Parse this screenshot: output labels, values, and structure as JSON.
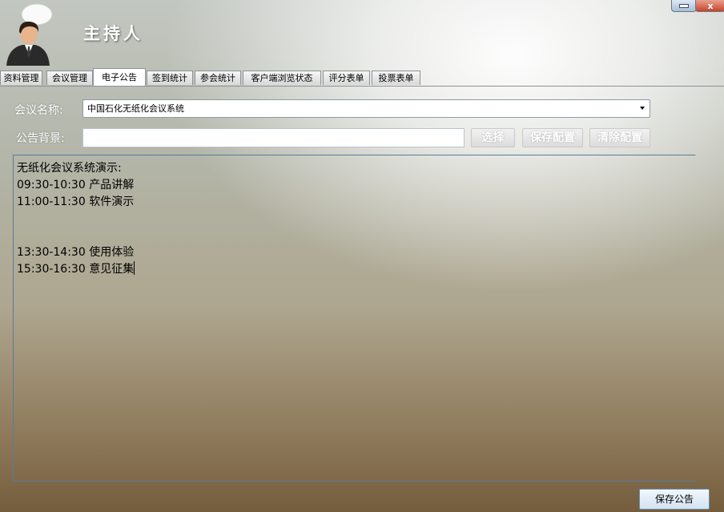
{
  "header": {
    "title": "主持人",
    "avatar_icon": "presenter-avatar-icon",
    "window_controls": {
      "minimize_icon": "minimize-icon",
      "close_label": "x"
    }
  },
  "tabs": [
    {
      "label": "资料管理",
      "active": false
    },
    {
      "label": "会议管理",
      "active": false
    },
    {
      "label": "电子公告",
      "active": true
    },
    {
      "label": "签到统计",
      "active": false
    },
    {
      "label": "参会统计",
      "active": false
    },
    {
      "label": "客户端浏览状态",
      "active": false
    },
    {
      "label": "评分表单",
      "active": false
    },
    {
      "label": "投票表单",
      "active": false
    }
  ],
  "form": {
    "meeting_label": "会议名称:",
    "meeting_value": "中国石化无纸化会议系统",
    "background_label": "公告背景:",
    "background_value": "",
    "buttons": {
      "choose": "选择",
      "save_config": "保存配置",
      "clear_config": "清除配置"
    }
  },
  "editor": {
    "lines": [
      "无纸化会议系统演示:",
      "09:30-10:30 产品讲解",
      "11:00-11:30 软件演示",
      "",
      "",
      "13:30-14:30 使用体验",
      "15:30-16:30 意见征集"
    ]
  },
  "footer": {
    "save_announcement": "保存公告"
  },
  "colors": {
    "accent": "#5a7b98",
    "tab_active_bg": "#ffffff",
    "close_button": "#c7442c"
  }
}
